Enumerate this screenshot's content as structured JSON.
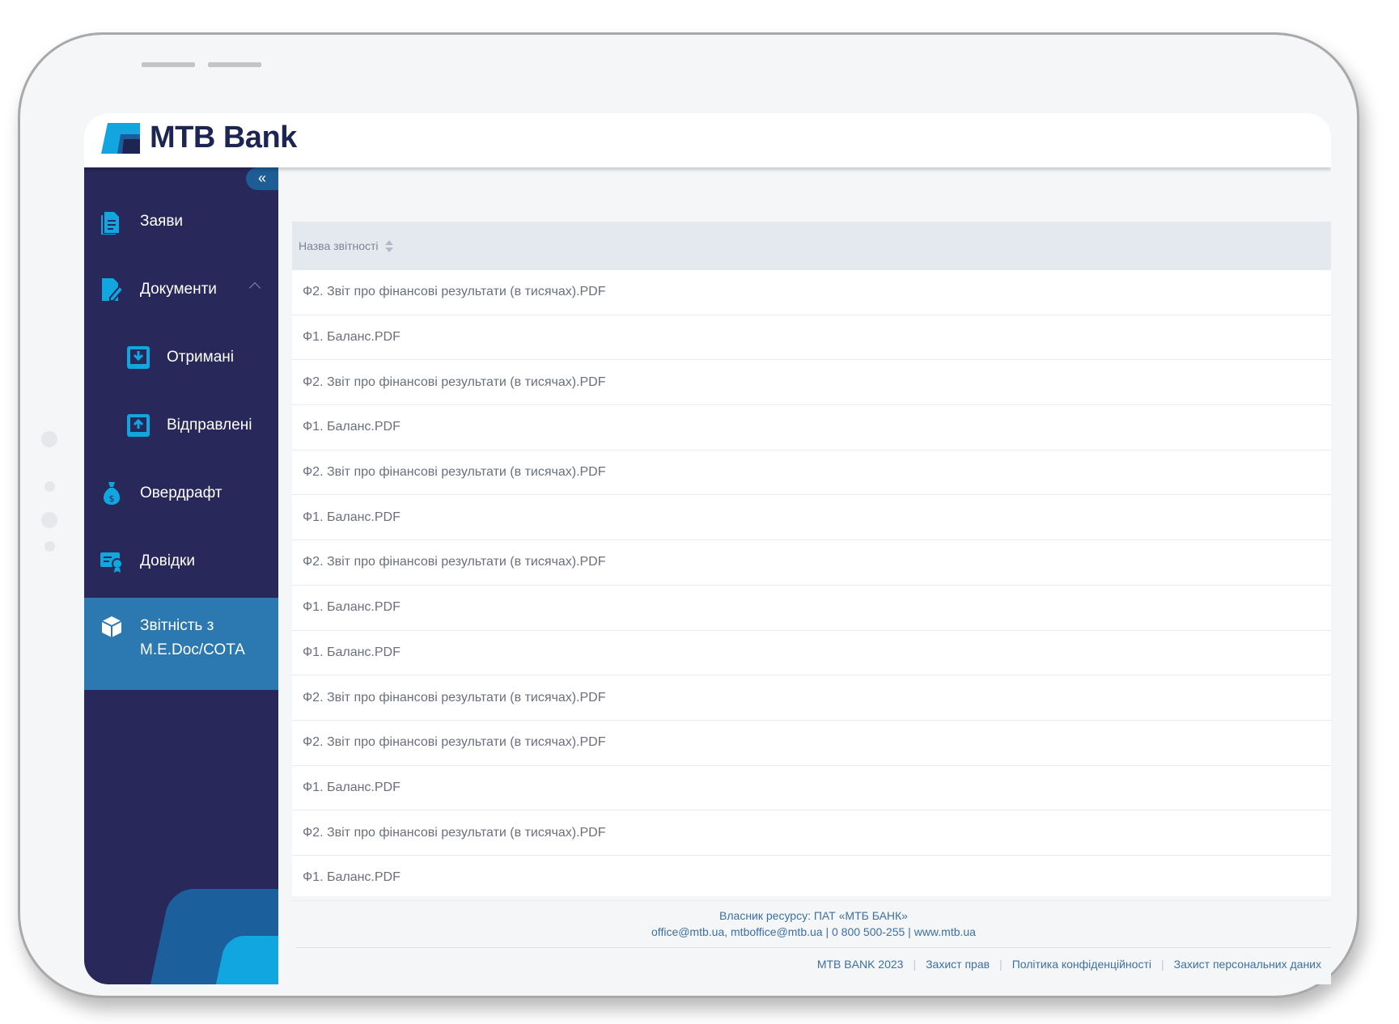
{
  "brand": {
    "name": "MTB Bank",
    "accent": "#12a6e0",
    "navy": "#28285a"
  },
  "sidebar": {
    "collapse_label": "«",
    "items": [
      {
        "label": "Заяви",
        "icon": "document-icon"
      },
      {
        "label": "Документи",
        "icon": "document-edit-icon",
        "expanded": true
      },
      {
        "label": "Отримані",
        "icon": "inbox-download-icon",
        "sub": true
      },
      {
        "label": "Відправлені",
        "icon": "outbox-upload-icon",
        "sub": true
      },
      {
        "label": "Овердрафт",
        "icon": "money-bag-icon"
      },
      {
        "label": "Довідки",
        "icon": "certificate-icon"
      },
      {
        "label": "Звітність з",
        "label2": "M.E.Doc/СОТА",
        "icon": "cube-icon",
        "active": true
      }
    ]
  },
  "table": {
    "header": "Назва звітності",
    "rows": [
      "Ф2. Звіт про фінансові результати (в тисячах).PDF",
      "Ф1. Баланс.PDF",
      "Ф2. Звіт про фінансові результати (в тисячах).PDF",
      "Ф1. Баланс.PDF",
      "Ф2. Звіт про фінансові результати (в тисячах).PDF",
      "Ф1. Баланс.PDF",
      "Ф2. Звіт про фінансові результати (в тисячах).PDF",
      "Ф1. Баланс.PDF",
      "Ф1. Баланс.PDF",
      "Ф2. Звіт про фінансові результати (в тисячах).PDF",
      "Ф2. Звіт про фінансові результати (в тисячах).PDF",
      "Ф1. Баланс.PDF",
      "Ф2. Звіт про фінансові результати (в тисячах).PDF",
      "Ф1. Баланс.PDF"
    ]
  },
  "footer": {
    "owner": "Власник ресурсу: ПАТ «МТБ БАНК»",
    "contacts": "office@mtb.ua, mtboffice@mtb.ua | 0 800 500-255 | www.mtb.ua",
    "links": [
      "MTB BANK 2023",
      "Захист прав",
      "Політика конфіденційності",
      "Захист персональних даних"
    ]
  }
}
